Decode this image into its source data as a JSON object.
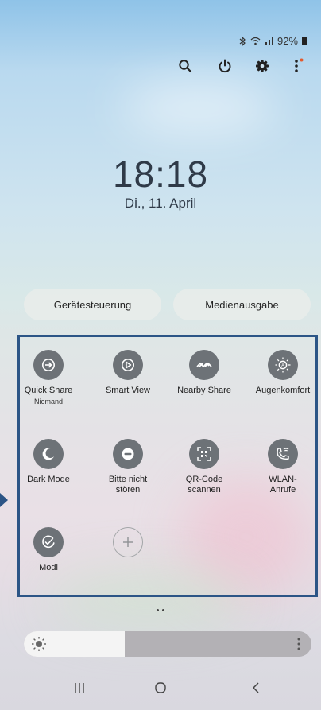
{
  "status": {
    "battery": "92%",
    "icons": [
      "bluetooth-icon",
      "wifi-icon",
      "signal-icon",
      "battery-icon"
    ]
  },
  "top_actions": [
    "search-icon",
    "power-icon",
    "settings-icon",
    "more-icon"
  ],
  "clock": {
    "time": "18:18",
    "date": "Di., 11. April"
  },
  "buttons": {
    "device_control": "Gerätesteuerung",
    "media_output": "Medienausgabe"
  },
  "tiles": [
    {
      "label": "Quick Share",
      "sub": "Niemand",
      "icon": "quick-share-icon"
    },
    {
      "label": "Smart View",
      "sub": "",
      "icon": "smart-view-icon"
    },
    {
      "label": "Nearby Share",
      "sub": "",
      "icon": "nearby-share-icon"
    },
    {
      "label": "Augenkomfort",
      "sub": "",
      "icon": "eye-comfort-icon"
    },
    {
      "label": "Dark Mode",
      "sub": "",
      "icon": "moon-icon"
    },
    {
      "label": "Bitte nicht stören",
      "sub": "",
      "icon": "do-not-disturb-icon"
    },
    {
      "label": "QR-Code scannen",
      "sub": "",
      "icon": "qr-code-icon"
    },
    {
      "label": "WLAN-Anrufe",
      "sub": "",
      "icon": "wifi-calling-icon"
    },
    {
      "label": "Modi",
      "sub": "",
      "icon": "modes-icon"
    },
    {
      "label": "",
      "sub": "",
      "icon": "add-icon"
    }
  ],
  "brightness": {
    "level": 0.35
  },
  "colors": {
    "panel_border": "#2c5586",
    "tile_bg": "#6d7277"
  }
}
